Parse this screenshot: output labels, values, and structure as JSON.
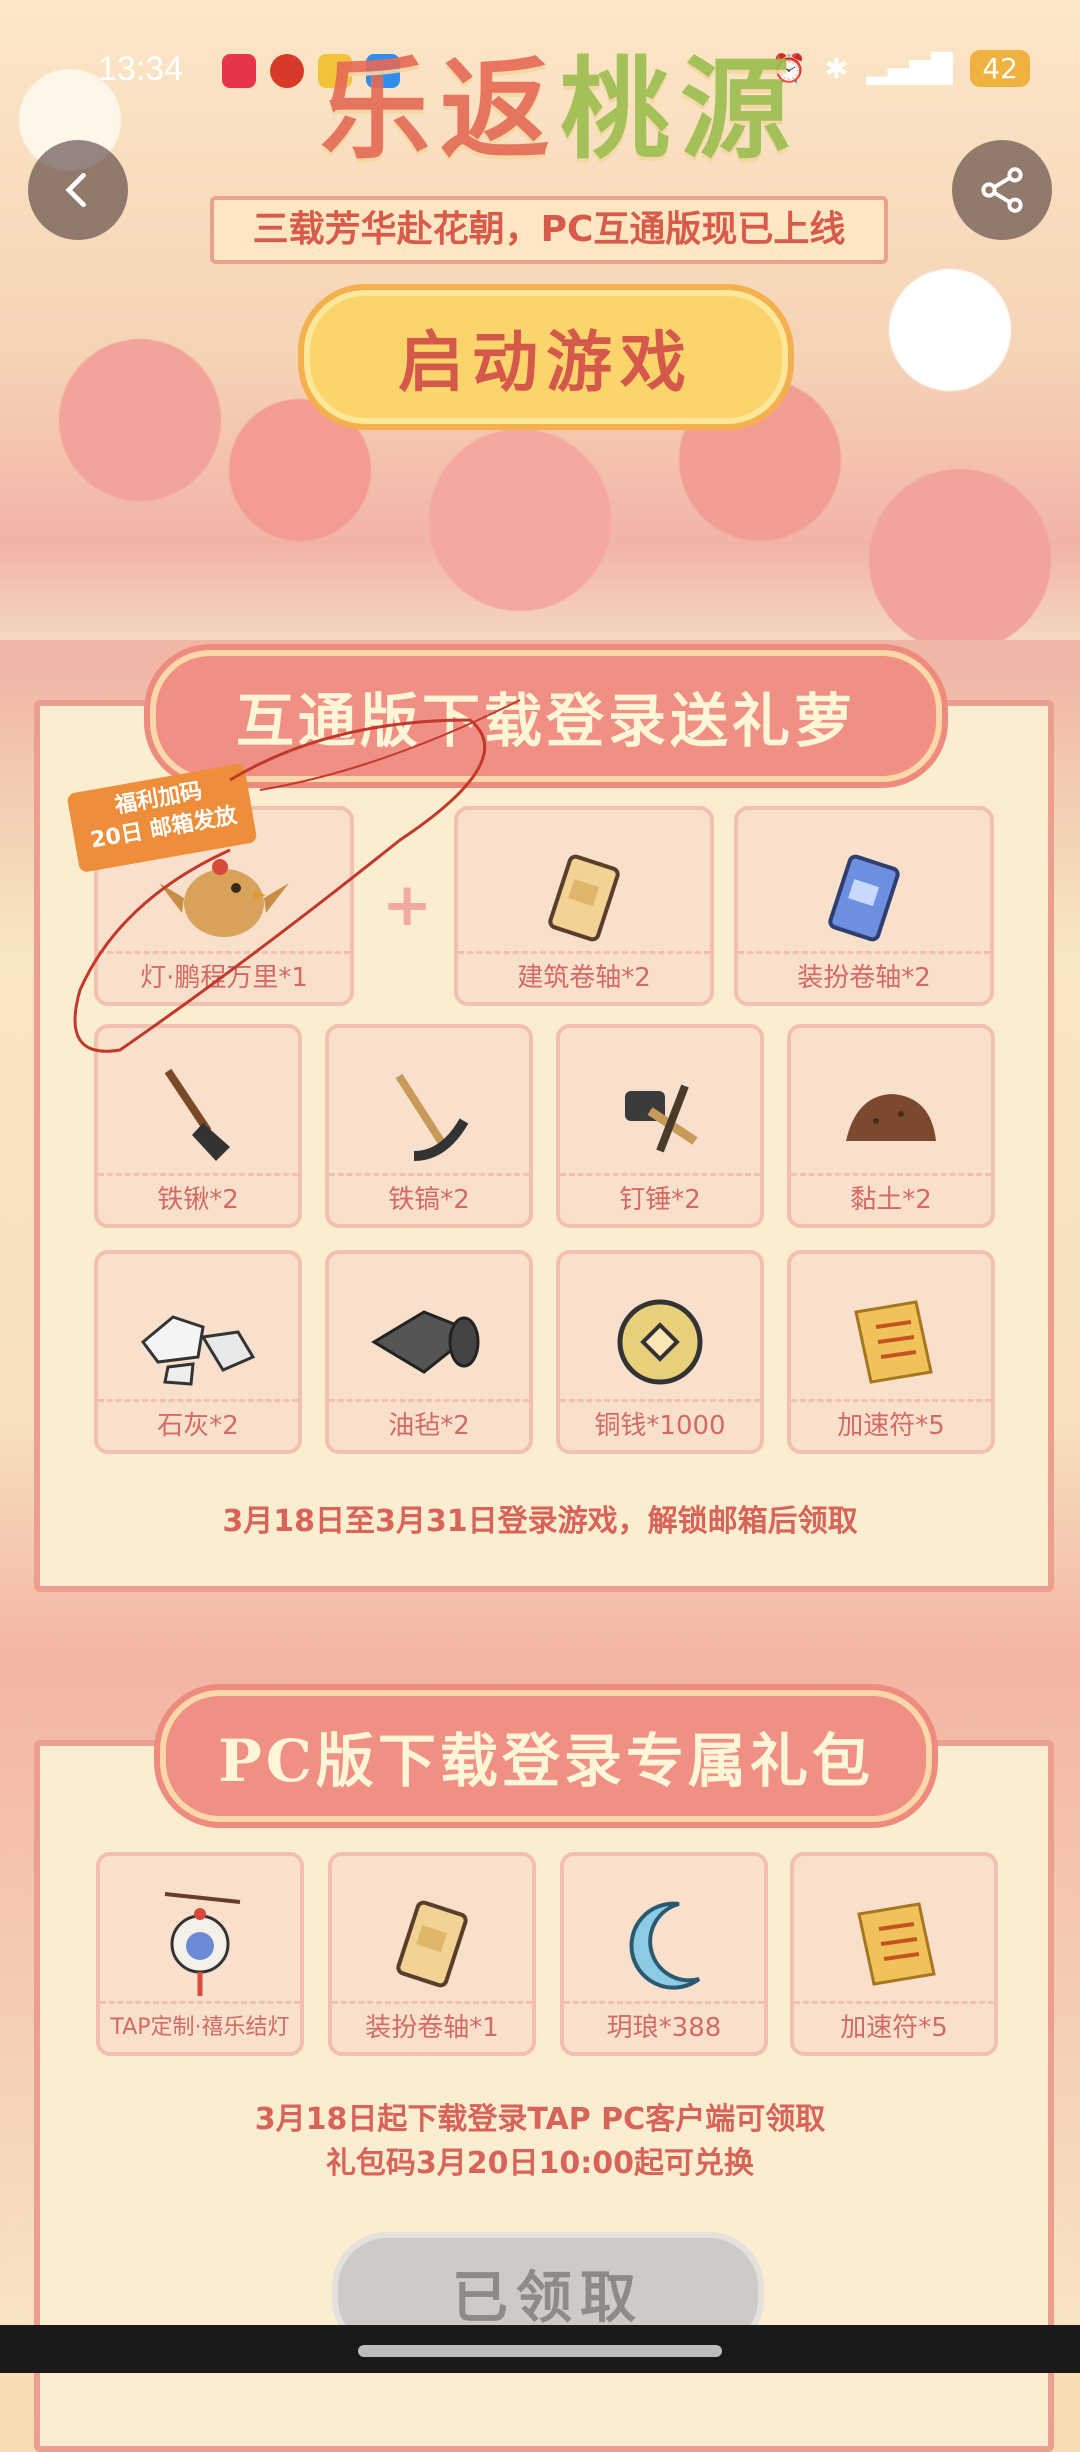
{
  "status_bar": {
    "time": "13:34",
    "battery": "42"
  },
  "banner": {
    "title_part1": "乐返",
    "title_part2": "桃源",
    "subtitle": "三载芳华赴花朝，PC互通版现已上线",
    "start_button": "启动游戏"
  },
  "section1": {
    "title": "互通版下载登录送礼萝",
    "badge_line1": "福利加码",
    "badge_line2": "20日 邮箱发放",
    "plus": "+",
    "items": [
      {
        "label": "灯·鹏程万里*1",
        "icon": "bird-lantern-icon"
      },
      {
        "label": "建筑卷轴*2",
        "icon": "scroll-icon"
      },
      {
        "label": "装扮卷轴*2",
        "icon": "blue-scroll-icon"
      },
      {
        "label": "铁锹*2",
        "icon": "shovel-icon"
      },
      {
        "label": "铁镐*2",
        "icon": "pickaxe-icon"
      },
      {
        "label": "钉锤*2",
        "icon": "hammer-icon"
      },
      {
        "label": "黏土*2",
        "icon": "clay-icon"
      },
      {
        "label": "石灰*2",
        "icon": "stone-icon"
      },
      {
        "label": "油毡*2",
        "icon": "felt-roll-icon"
      },
      {
        "label": "铜钱*1000",
        "icon": "coin-icon"
      },
      {
        "label": "加速符*5",
        "icon": "talisman-icon"
      }
    ],
    "note": "3月18日至3月31日登录游戏，解锁邮箱后领取"
  },
  "section2": {
    "title": "PC版下载登录专属礼包",
    "items": [
      {
        "label": "TAP定制·禧乐结灯",
        "icon": "lantern-icon"
      },
      {
        "label": "装扮卷轴*1",
        "icon": "scroll-icon"
      },
      {
        "label": "玥琅*388",
        "icon": "moon-icon"
      },
      {
        "label": "加速符*5",
        "icon": "talisman-icon"
      }
    ],
    "note_line1": "3月18日起下载登录TAP PC客户端可领取",
    "note_line2": "礼包码3月20日10:00起可兑换",
    "claimed_button": "已领取"
  }
}
